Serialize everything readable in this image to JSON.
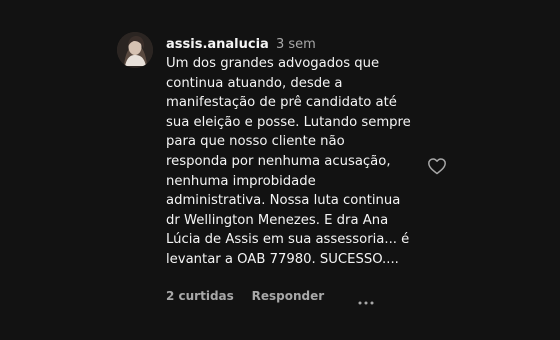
{
  "comment": {
    "username": "assis.analucia",
    "timestamp": "3 sem",
    "text": "Um dos grandes advogados que\ncontinua atuando, desde a\nmanifestação de prê candidato até\nsua eleição e posse. Lutando sempre\npara que nosso cliente não\nresponda por nenhuma acusação,\nnenhuma improbidade\nadministrativa. Nossa luta continua\ndr Wellington Menezes. E dra Ana\nLúcia de Assis em sua assessoria... é\nlevantar a OAB 77980. SUCESSO....",
    "likes_label": "2 curtidas",
    "reply_label": "Responder",
    "icons": {
      "avatar": "profile-avatar",
      "like": "heart-outline-icon",
      "more": "ellipsis-icon"
    }
  }
}
